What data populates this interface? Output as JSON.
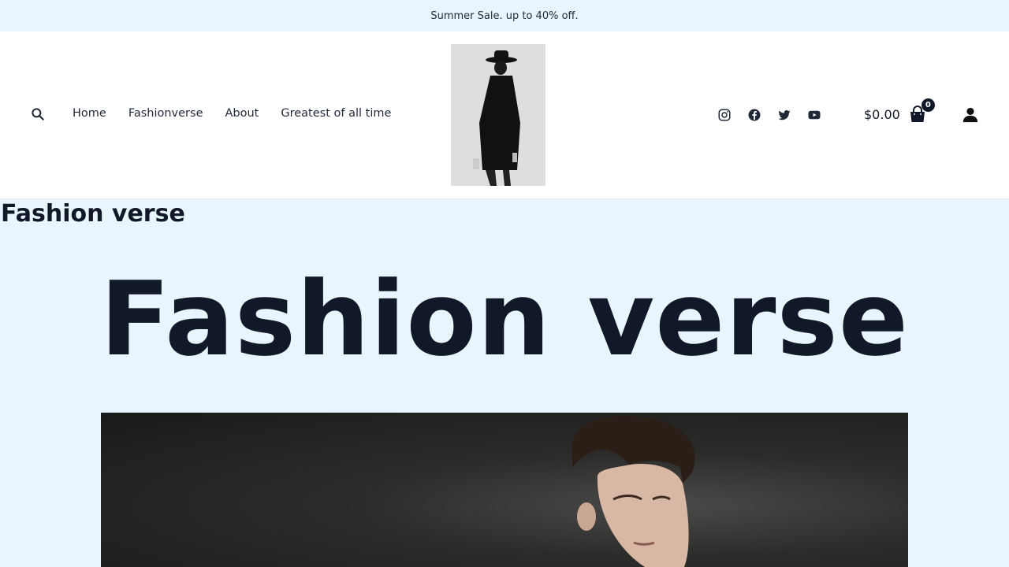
{
  "announcement": {
    "text": "Summer Sale. up to 40% off."
  },
  "nav": {
    "items": [
      {
        "label": "Home"
      },
      {
        "label": "Fashionverse"
      },
      {
        "label": "About"
      },
      {
        "label": "Greatest of all time"
      }
    ]
  },
  "social": {
    "icons": [
      "instagram-icon",
      "facebook-icon",
      "twitter-icon",
      "youtube-icon"
    ],
    "color": "#1f2937"
  },
  "cart": {
    "total": "$0.00",
    "count": "0"
  },
  "page": {
    "title": "Fashion verse",
    "hero_title": "Fashion verse"
  },
  "colors": {
    "background": "#e8f4fe",
    "header": "#ffffff",
    "text": "#111827"
  }
}
